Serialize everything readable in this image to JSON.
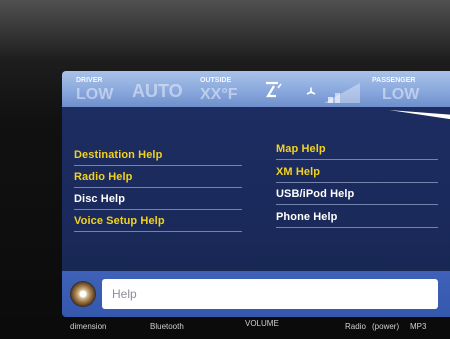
{
  "climate": {
    "driver_label": "DRIVER",
    "driver_value": "LOW",
    "mode": "AUTO",
    "outside_label": "OUTSIDE",
    "outside_value": "XX°F",
    "passenger_label": "PASSENGER",
    "passenger_value": "LOW"
  },
  "help_menu": {
    "left": [
      {
        "label": "Destination Help",
        "color": "#f2d21d"
      },
      {
        "label": "Radio Help",
        "color": "#f2d21d"
      },
      {
        "label": "Disc Help",
        "color": "#ffffff"
      },
      {
        "label": "Voice Setup Help",
        "color": "#f2d21d"
      }
    ],
    "right": [
      {
        "label": "Map Help",
        "color": "#f2d21d"
      },
      {
        "label": "XM Help",
        "color": "#f2d21d"
      },
      {
        "label": "USB/iPod Help",
        "color": "#ffffff"
      },
      {
        "label": "Phone Help",
        "color": "#ffffff"
      }
    ]
  },
  "bottom_bar": {
    "field_text": "Help",
    "knob_icon": "control-knob-icon"
  },
  "footer": {
    "brand": "dimension",
    "bluetooth": "Bluetooth",
    "volume": "VOLUME",
    "radio": "Radio",
    "power": "(power)",
    "mp3": "MP3"
  },
  "colors": {
    "screen_bg": "#1e2e63",
    "climate_bar": "#87a6dc",
    "yellow_text": "#f2d21d",
    "bottom_bar": "#3f62b8"
  }
}
